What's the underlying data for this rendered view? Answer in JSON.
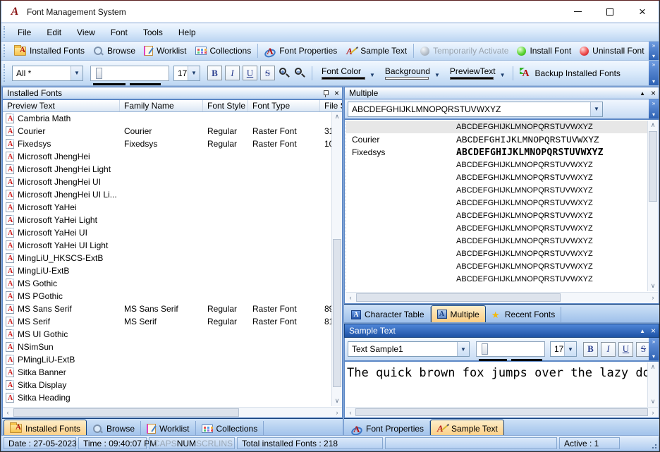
{
  "window": {
    "title": "Font Management System"
  },
  "menu": {
    "items": [
      {
        "label": "File"
      },
      {
        "label": "Edit"
      },
      {
        "label": "View"
      },
      {
        "label": "Font"
      },
      {
        "label": "Tools"
      },
      {
        "label": "Help"
      }
    ]
  },
  "toolbar_main": {
    "installed_fonts": "Installed Fonts",
    "browse": "Browse",
    "worklist": "Worklist",
    "collections": "Collections",
    "font_properties": "Font Properties",
    "sample_text": "Sample Text",
    "temporarily_activate": "Temporarily Activate",
    "install_font": "Install Font",
    "uninstall_font": "Uninstall Font"
  },
  "toolbar_format": {
    "filter_value": "All *",
    "size_value": "17",
    "bold": "B",
    "italic": "I",
    "underline": "U",
    "strikeout": "S",
    "font_color_label": "Font Color",
    "background_label": "Background",
    "preview_text_label": "PreviewText",
    "backup_label": "Backup Installed Fonts"
  },
  "installed_panel": {
    "title": "Installed Fonts",
    "columns": [
      "Preview Text",
      "Family Name",
      "Font Style",
      "Font Type",
      "File Siz"
    ],
    "rows": [
      {
        "preview": "Cambria Math",
        "family": "",
        "style": "",
        "type": "",
        "size": ""
      },
      {
        "preview": "Courier",
        "family": "Courier",
        "style": "Regular",
        "type": "Raster Font",
        "size": "31"
      },
      {
        "preview": "Fixedsys",
        "family": "Fixedsys",
        "style": "Regular",
        "type": "Raster Font",
        "size": "10"
      },
      {
        "preview": "Microsoft JhengHei",
        "family": "",
        "style": "",
        "type": "",
        "size": ""
      },
      {
        "preview": "Microsoft JhengHei Light",
        "family": "",
        "style": "",
        "type": "",
        "size": ""
      },
      {
        "preview": "Microsoft JhengHei UI",
        "family": "",
        "style": "",
        "type": "",
        "size": ""
      },
      {
        "preview": "Microsoft JhengHei UI Li...",
        "family": "",
        "style": "",
        "type": "",
        "size": ""
      },
      {
        "preview": "Microsoft YaHei",
        "family": "",
        "style": "",
        "type": "",
        "size": ""
      },
      {
        "preview": "Microsoft YaHei Light",
        "family": "",
        "style": "",
        "type": "",
        "size": ""
      },
      {
        "preview": "Microsoft YaHei UI",
        "family": "",
        "style": "",
        "type": "",
        "size": ""
      },
      {
        "preview": "Microsoft YaHei UI Light",
        "family": "",
        "style": "",
        "type": "",
        "size": ""
      },
      {
        "preview": "MingLiU_HKSCS-ExtB",
        "family": "",
        "style": "",
        "type": "",
        "size": ""
      },
      {
        "preview": "MingLiU-ExtB",
        "family": "",
        "style": "",
        "type": "",
        "size": ""
      },
      {
        "preview": "MS Gothic",
        "family": "",
        "style": "",
        "type": "",
        "size": ""
      },
      {
        "preview": "MS PGothic",
        "family": "",
        "style": "",
        "type": "",
        "size": ""
      },
      {
        "preview": "MS Sans Serif",
        "family": "MS Sans Serif",
        "style": "Regular",
        "type": "Raster Font",
        "size": "89"
      },
      {
        "preview": "MS Serif",
        "family": "MS Serif",
        "style": "Regular",
        "type": "Raster Font",
        "size": "81"
      },
      {
        "preview": "MS UI Gothic",
        "family": "",
        "style": "",
        "type": "",
        "size": ""
      },
      {
        "preview": "NSimSun",
        "family": "",
        "style": "",
        "type": "",
        "size": ""
      },
      {
        "preview": "PMingLiU-ExtB",
        "family": "",
        "style": "",
        "type": "",
        "size": ""
      },
      {
        "preview": "Sitka Banner",
        "family": "",
        "style": "",
        "type": "",
        "size": ""
      },
      {
        "preview": "Sitka Display",
        "family": "",
        "style": "",
        "type": "",
        "size": ""
      },
      {
        "preview": "Sitka Heading",
        "family": "",
        "style": "",
        "type": "",
        "size": ""
      }
    ]
  },
  "multiple_panel": {
    "title": "Multiple",
    "combo_value": "ABCDEFGHIJKLMNOPQRSTUVWXYZ",
    "rows": [
      {
        "name": "",
        "preview": "ABCDEFGHIJKLMNOPQRSTUVWXYZ",
        "font": "plain",
        "selected": true
      },
      {
        "name": "Courier",
        "preview": "ABCDEFGHIJKLMNOPQRSTUVWXYZ",
        "font": "courier",
        "selected": false
      },
      {
        "name": "Fixedsys",
        "preview": "ABCDEFGHIJKLMNOPQRSTUVWXYZ",
        "font": "fixedsys",
        "selected": false
      },
      {
        "name": "",
        "preview": "ABCDEFGHIJKLMNOPQRSTUVWXYZ",
        "font": "plain",
        "selected": false
      },
      {
        "name": "",
        "preview": "ABCDEFGHIJKLMNOPQRSTUVWXYZ",
        "font": "plain",
        "selected": false
      },
      {
        "name": "",
        "preview": "ABCDEFGHIJKLMNOPQRSTUVWXYZ",
        "font": "plain",
        "selected": false
      },
      {
        "name": "",
        "preview": "ABCDEFGHIJKLMNOPQRSTUVWXYZ",
        "font": "plain",
        "selected": false
      },
      {
        "name": "",
        "preview": "ABCDEFGHIJKLMNOPQRSTUVWXYZ",
        "font": "plain",
        "selected": false
      },
      {
        "name": "",
        "preview": "ABCDEFGHIJKLMNOPQRSTUVWXYZ",
        "font": "plain",
        "selected": false
      },
      {
        "name": "",
        "preview": "ABCDEFGHIJKLMNOPQRSTUVWXYZ",
        "font": "plain",
        "selected": false
      },
      {
        "name": "",
        "preview": "ABCDEFGHIJKLMNOPQRSTUVWXYZ",
        "font": "plain",
        "selected": false
      },
      {
        "name": "",
        "preview": "ABCDEFGHIJKLMNOPQRSTUVWXYZ",
        "font": "plain",
        "selected": false
      },
      {
        "name": "",
        "preview": "ABCDEFGHIJKLMNOPQRSTUVWXYZ",
        "font": "plain",
        "selected": false
      }
    ]
  },
  "view_tabs": {
    "character_table": "Character Table",
    "multiple": "Multiple",
    "recent_fonts": "Recent Fonts"
  },
  "sample_panel": {
    "title": "Sample Text",
    "combo_value": "Text Sample1",
    "size_value": "17",
    "bold": "B",
    "italic": "I",
    "underline": "U",
    "strikeout": "S",
    "text": "The quick brown fox jumps over the lazy do"
  },
  "left_tabs": {
    "installed_fonts": "Installed Fonts",
    "browse": "Browse",
    "worklist": "Worklist",
    "collections": "Collections"
  },
  "right_tabs": {
    "font_properties": "Font Properties",
    "sample_text": "Sample Text"
  },
  "statusbar": {
    "date": "Date : 27-05-2023",
    "time": "Time : 09:40:07 PM",
    "caps": "CAPS",
    "num": "NUM",
    "scrl": "SCRL",
    "ins": "INS",
    "total": "Total installed Fonts : 218",
    "active": "Active : 1"
  },
  "colors": {
    "active_tab": "#fbce84",
    "install_green": "#1b9b05",
    "uninstall_red": "#b00716",
    "disabled_gray": "#9aa4af",
    "font_color_swatch": "#000000",
    "background_swatch": "#ffffff",
    "preview_text_swatch": "#000000",
    "header_active_blue": "#1d52a5"
  }
}
